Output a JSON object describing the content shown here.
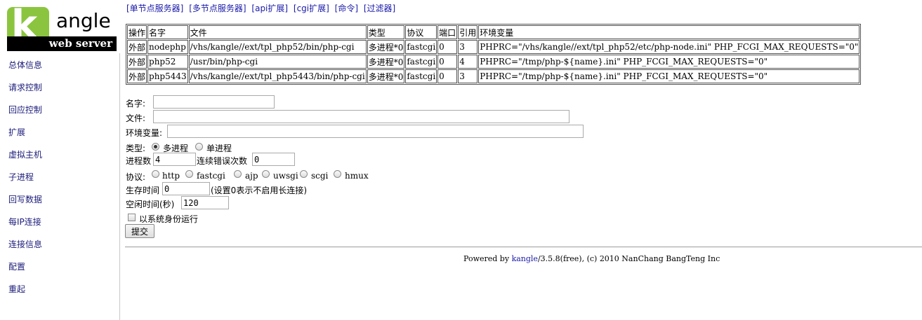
{
  "logo": {
    "letter": "k",
    "name": "angle",
    "tagline": "web server"
  },
  "sidebar": {
    "items": [
      {
        "label": "总体信息"
      },
      {
        "label": "请求控制"
      },
      {
        "label": "回应控制"
      },
      {
        "label": "扩展"
      },
      {
        "label": "虚拟主机"
      },
      {
        "label": "子进程"
      },
      {
        "label": "回写数据"
      },
      {
        "label": "每IP连接"
      },
      {
        "label": "连接信息"
      },
      {
        "label": "配置"
      },
      {
        "label": "重起"
      }
    ]
  },
  "toplinks": [
    {
      "label": "[单节点服务器]"
    },
    {
      "label": "[多节点服务器]"
    },
    {
      "label": "[api扩展]"
    },
    {
      "label": "[cgi扩展]"
    },
    {
      "label": "[命令]"
    },
    {
      "label": "[过滤器]"
    }
  ],
  "table": {
    "headers": [
      "操作",
      "名字",
      "文件",
      "类型",
      "协议",
      "端口",
      "引用",
      "环境变量"
    ],
    "rows": [
      [
        "外部",
        "nodephp",
        "/vhs/kangle//ext/tpl_php52/bin/php-cgi",
        "多进程*0",
        "fastcgi",
        "0",
        "3",
        "PHPRC=\"/vhs/kangle//ext/tpl_php52/etc/php-node.ini\" PHP_FCGI_MAX_REQUESTS=\"0\""
      ],
      [
        "外部",
        "php52",
        "/usr/bin/php-cgi",
        "多进程*0",
        "fastcgi",
        "0",
        "4",
        "PHPRC=\"/tmp/php-${name}.ini\" PHP_FCGI_MAX_REQUESTS=\"0\""
      ],
      [
        "外部",
        "php5443",
        "/vhs/kangle//ext/tpl_php5443/bin/php-cgi",
        "多进程*0",
        "fastcgi",
        "0",
        "3",
        "PHPRC=\"/tmp/php-${name}.ini\" PHP_FCGI_MAX_REQUESTS=\"0\""
      ]
    ]
  },
  "form": {
    "name_label": "名字:",
    "name_value": "",
    "file_label": "文件:",
    "file_value": "",
    "env_label": "环境变量:",
    "env_value": "",
    "type_label": "类型:",
    "type_options": [
      "多进程",
      "单进程"
    ],
    "type_selected": "多进程",
    "procs_label": "进程数",
    "procs_value": "4",
    "errors_label": "连续错误次数",
    "errors_value": "0",
    "proto_label": "协议:",
    "proto_options": [
      "http",
      "fastcgi",
      "ajp",
      "uwsgi",
      "scgi",
      "hmux"
    ],
    "proto_selected": null,
    "life_label": "生存时间",
    "life_value": "0",
    "life_hint": "(设置0表示不启用长连接)",
    "idle_label": "空闲时间(秒)",
    "idle_value": "120",
    "sysuser_label": "以系统身份运行",
    "sysuser_checked": false,
    "submit_label": "提交"
  },
  "footer": {
    "prefix": "Powered by ",
    "link": "kangle",
    "suffix": "/3.5.8(free), (c) 2010 NanChang BangTeng Inc"
  }
}
